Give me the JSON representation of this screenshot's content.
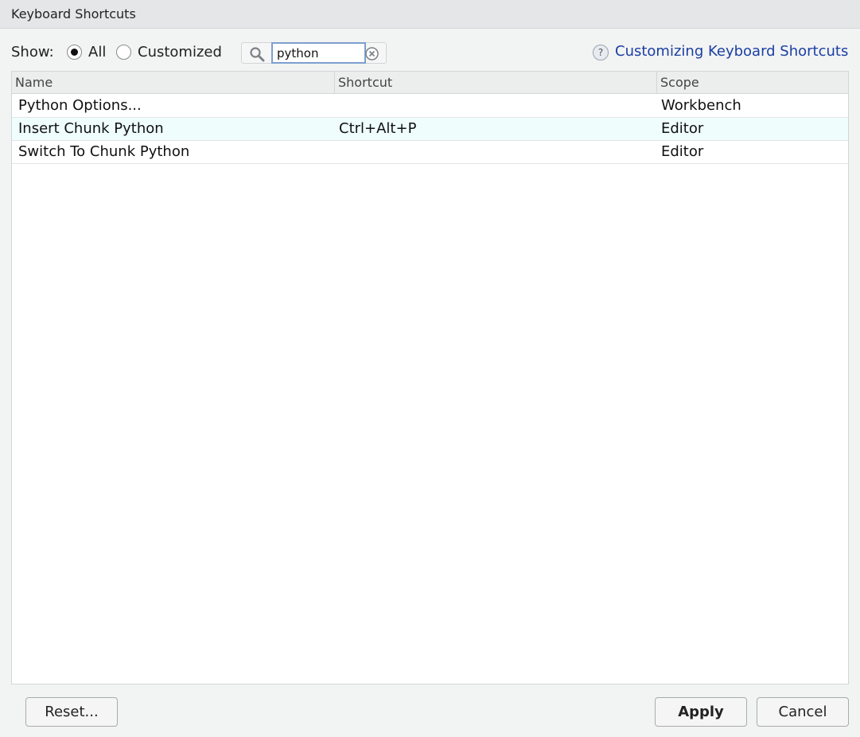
{
  "window": {
    "title": "Keyboard Shortcuts"
  },
  "filter": {
    "show_label": "Show:",
    "options": [
      {
        "label": "All",
        "checked": true
      },
      {
        "label": "Customized",
        "checked": false
      }
    ]
  },
  "search": {
    "value": "python",
    "icon": "search-icon",
    "clear_icon": "clear-icon"
  },
  "help": {
    "icon_glyph": "?",
    "link_label": "Customizing Keyboard Shortcuts"
  },
  "table": {
    "columns": [
      "Name",
      "Shortcut",
      "Scope"
    ],
    "rows": [
      {
        "name": "Python Options...",
        "shortcut": "",
        "scope": "Workbench"
      },
      {
        "name": "Insert Chunk Python",
        "shortcut": "Ctrl+Alt+P",
        "scope": "Editor"
      },
      {
        "name": "Switch To Chunk Python",
        "shortcut": "",
        "scope": "Editor"
      }
    ]
  },
  "buttons": {
    "reset": "Reset...",
    "apply": "Apply",
    "cancel": "Cancel"
  }
}
